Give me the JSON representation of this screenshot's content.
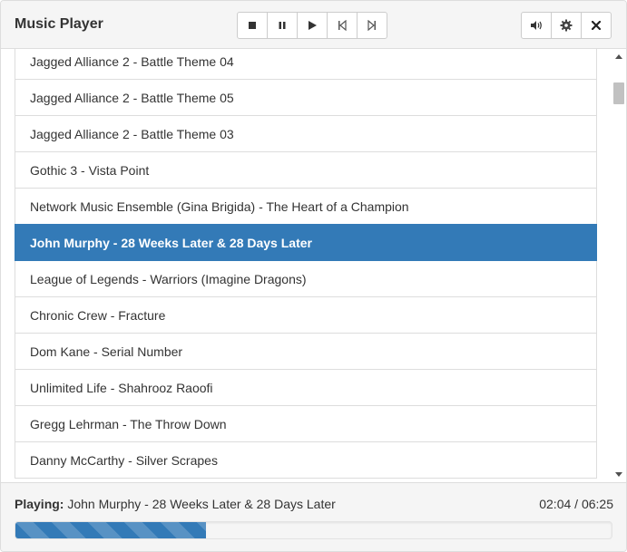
{
  "app": {
    "title": "Music Player"
  },
  "transport": {
    "buttons": [
      {
        "name": "stop-button",
        "icon": "stop-icon"
      },
      {
        "name": "pause-button",
        "icon": "pause-icon"
      },
      {
        "name": "play-button",
        "icon": "play-icon"
      },
      {
        "name": "previous-button",
        "icon": "step-backward-icon"
      },
      {
        "name": "next-button",
        "icon": "step-forward-icon"
      }
    ]
  },
  "utility": {
    "buttons": [
      {
        "name": "volume-button",
        "icon": "volume-icon"
      },
      {
        "name": "settings-button",
        "icon": "gear-icon"
      },
      {
        "name": "close-button",
        "icon": "close-icon"
      }
    ]
  },
  "playlist": {
    "active_index": 5,
    "tracks": [
      "Jagged Alliance 2 - Battle Theme 04",
      "Jagged Alliance 2 - Battle Theme 05",
      "Jagged Alliance 2 - Battle Theme 03",
      "Gothic 3 - Vista Point",
      "Network Music Ensemble (Gina Brigida) - The Heart of a Champion",
      "John Murphy - 28 Weeks Later & 28 Days Later",
      "League of Legends - Warriors (Imagine Dragons)",
      "Chronic Crew - Fracture",
      "Dom Kane - Serial Number",
      "Unlimited Life - Shahrooz Raoofi",
      "Gregg Lehrman - The Throw Down",
      "Danny McCarthy - Silver Scrapes"
    ]
  },
  "footer": {
    "playing_label": "Playing:",
    "playing_track": "John Murphy - 28 Weeks Later & 28 Days Later",
    "elapsed": "02:04",
    "separator": "/",
    "duration": "06:25",
    "progress_fraction": 0.32
  },
  "colors": {
    "accent": "#337ab7",
    "header_bg": "#f5f5f5",
    "border": "#dddddd"
  }
}
